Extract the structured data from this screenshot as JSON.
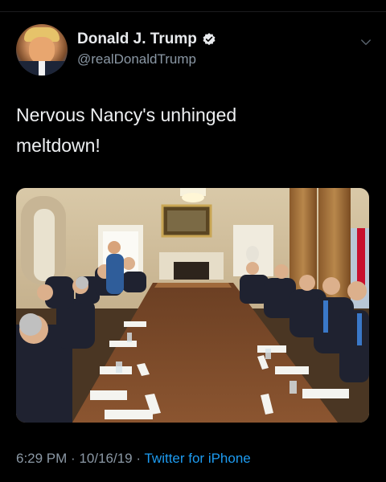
{
  "tweet": {
    "author": {
      "display_name": "Donald J. Trump",
      "handle": "@realDonaldTrump",
      "verified": true
    },
    "text_lines": [
      "Nervous Nancy's unhinged",
      "meltdown!"
    ],
    "time": "6:29 PM",
    "date": "10/16/19",
    "separator": "·",
    "source": "Twitter for iPhone"
  },
  "icons": {
    "verified": "verified-badge-icon",
    "more": "chevron-down-icon"
  },
  "colors": {
    "background": "#000000",
    "text": "#eef0f2",
    "secondary_text": "#8b98a5",
    "link": "#1d9bf0"
  }
}
